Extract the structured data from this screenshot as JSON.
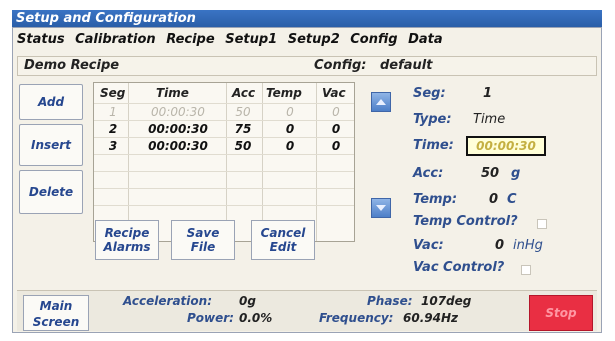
{
  "window": {
    "title": "Setup and Configuration"
  },
  "tabs": [
    "Status",
    "Calibration",
    "Recipe",
    "Setup1",
    "Setup2",
    "Config",
    "Data"
  ],
  "recipe": {
    "name": "Demo Recipe",
    "config_label": "Config:",
    "config_value": "default"
  },
  "side_buttons": {
    "add": "Add",
    "insert": "Insert",
    "delete": "Delete"
  },
  "table": {
    "headers": [
      "Seg",
      "Time",
      "Acc",
      "Temp",
      "Vac"
    ],
    "rows": [
      [
        "1",
        "00:00:30",
        "50",
        "0",
        "0"
      ],
      [
        "2",
        "00:00:30",
        "75",
        "0",
        "0"
      ],
      [
        "3",
        "00:00:30",
        "50",
        "0",
        "0"
      ]
    ]
  },
  "bottom_buttons": {
    "recipe_alarms": [
      "Recipe",
      "Alarms"
    ],
    "save_file": [
      "Save",
      "File"
    ],
    "cancel_edit": [
      "Cancel",
      "Edit"
    ]
  },
  "props": {
    "seg_label": "Seg:",
    "seg_value": "1",
    "type_label": "Type:",
    "type_value": "Time",
    "time_label": "Time:",
    "time_value": "00:00:30",
    "acc_label": "Acc:",
    "acc_value": "50",
    "acc_unit": "g",
    "temp_label": "Temp:",
    "temp_value": "0",
    "temp_unit": "C",
    "temp_control": "Temp Control?",
    "vac_label": "Vac:",
    "vac_value": "0",
    "vac_unit": "inHg",
    "vac_control": "Vac Control?"
  },
  "status": {
    "main_screen": [
      "Main",
      "Screen"
    ],
    "acceleration_label": "Acceleration:",
    "acceleration_value": "0g",
    "power_label": "Power:",
    "power_value": "0.0%",
    "phase_label": "Phase:",
    "phase_value": "107deg",
    "frequency_label": "Frequency:",
    "frequency_value": "60.94Hz",
    "stop": "Stop"
  },
  "colors": {
    "titlebar": "#2a5ea8",
    "stop": "#e92f43",
    "highlight": "#ffffd8"
  }
}
